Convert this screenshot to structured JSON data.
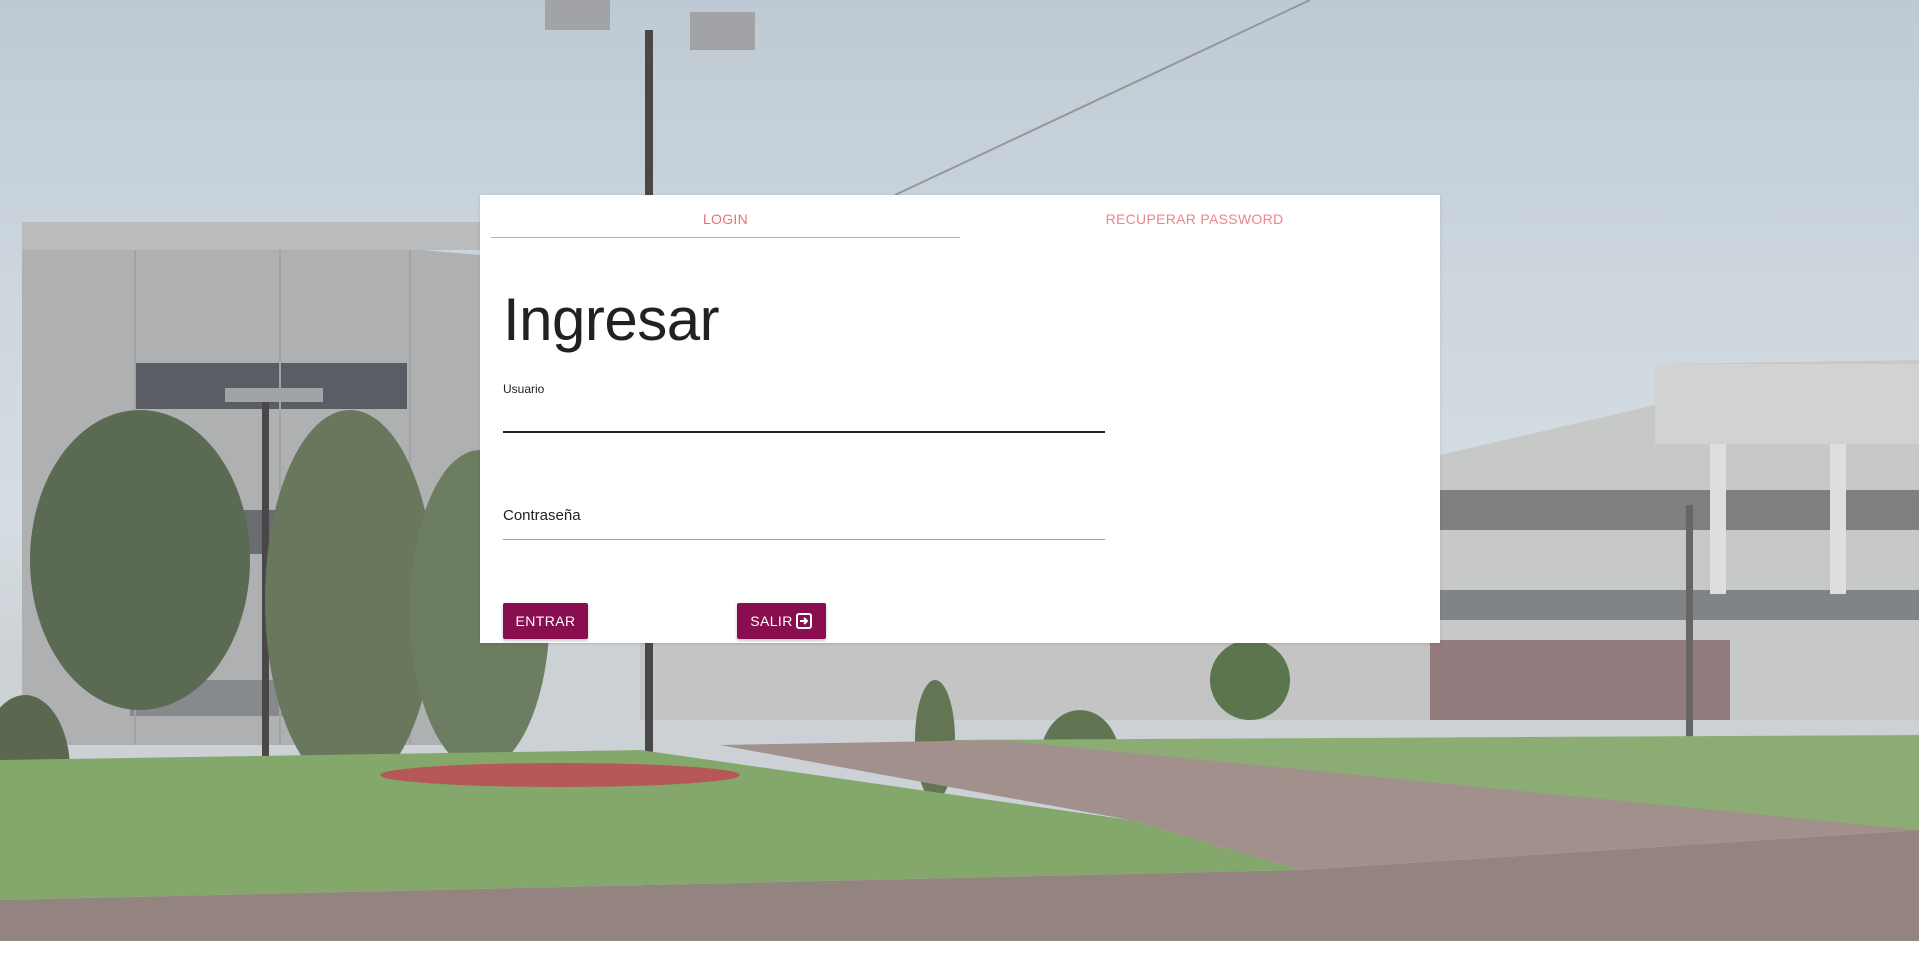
{
  "tabs": [
    {
      "label": "LOGIN",
      "active": true
    },
    {
      "label": "RECUPERAR PASSWORD",
      "active": false
    }
  ],
  "login": {
    "title": "Ingresar",
    "username": {
      "label": "Usuario",
      "value": ""
    },
    "password": {
      "label": "Contraseña",
      "value": ""
    },
    "buttons": {
      "enter_label": "ENTRAR",
      "exit_label": "SALIR",
      "exit_icon": "exit-icon"
    }
  },
  "colors": {
    "button_bg": "#880e4f",
    "tab_accent": "#e57373",
    "card_bg": "#ffffff"
  }
}
